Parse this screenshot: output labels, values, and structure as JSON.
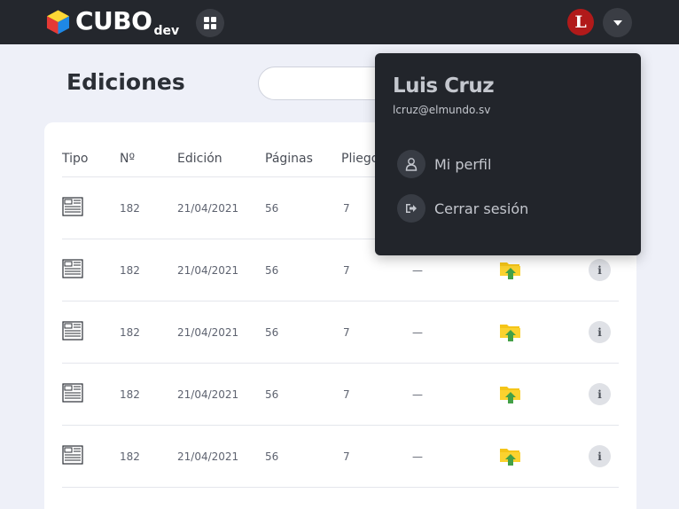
{
  "brand": {
    "name": "CUBO",
    "suffix": "dev",
    "cube_colors": [
      "#e53935",
      "#1e88e5",
      "#fdd835"
    ]
  },
  "user": {
    "avatar_letter": "L",
    "avatar_color": "#b11a1a",
    "name": "Luis Cruz",
    "email": "lcruz@elmundo.sv"
  },
  "icons": {
    "apps": "grid-icon",
    "account_menu": "caret-down-icon",
    "profile": "user-icon",
    "logout": "logout-icon",
    "document": "newspaper-icon",
    "folder": "folder-upload-icon",
    "info": "info-icon"
  },
  "page": {
    "title": "Ediciones"
  },
  "search": {
    "value": "",
    "placeholder": ""
  },
  "table": {
    "columns": [
      "Tipo",
      "Nº",
      "Edición",
      "Páginas",
      "Pliegos"
    ],
    "rows": [
      {
        "numero": "182",
        "edicion": "21/04/2021",
        "paginas": "56",
        "pliegos": "7",
        "extra": ""
      },
      {
        "numero": "182",
        "edicion": "21/04/2021",
        "paginas": "56",
        "pliegos": "7",
        "extra": "—"
      },
      {
        "numero": "182",
        "edicion": "21/04/2021",
        "paginas": "56",
        "pliegos": "7",
        "extra": "—"
      },
      {
        "numero": "182",
        "edicion": "21/04/2021",
        "paginas": "56",
        "pliegos": "7",
        "extra": "—"
      },
      {
        "numero": "182",
        "edicion": "21/04/2021",
        "paginas": "56",
        "pliegos": "7",
        "extra": "—"
      }
    ],
    "info_glyph": "i"
  },
  "menu": {
    "items": [
      {
        "label": "Mi perfil"
      },
      {
        "label": "Cerrar sesión"
      }
    ]
  }
}
